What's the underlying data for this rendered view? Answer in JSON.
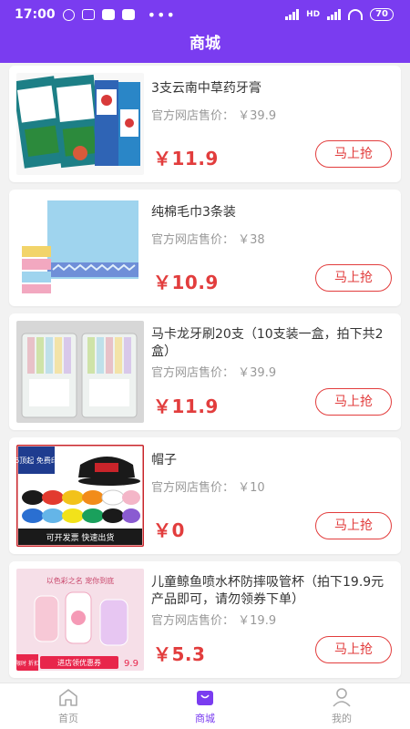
{
  "status_bar": {
    "time": "17:00",
    "more": "•••",
    "network": "HD",
    "battery": "70"
  },
  "header": {
    "title": "商城"
  },
  "products": [
    {
      "name": "3支云南中草药牙膏",
      "ref_label": "官方网店售价：",
      "ref_price": "￥39.9",
      "price": "￥11.9",
      "buy_label": "马上抢",
      "image_icon": "toothpaste-image"
    },
    {
      "name": "纯棉毛巾3条装",
      "ref_label": "官方网店售价：",
      "ref_price": "￥38",
      "price": "￥10.9",
      "buy_label": "马上抢",
      "image_icon": "towel-image"
    },
    {
      "name": "马卡龙牙刷20支（10支装一盒，拍下共2盒）",
      "ref_label": "官方网店售价：",
      "ref_price": "￥39.9",
      "price": "￥11.9",
      "buy_label": "马上抢",
      "image_icon": "toothbrush-image"
    },
    {
      "name": "帽子",
      "ref_label": "官方网店售价：",
      "ref_price": "￥10",
      "price": "￥0",
      "buy_label": "马上抢",
      "image_icon": "cap-image",
      "image_text": {
        "badge": "5顶起 免费印",
        "footer": "可开发票  快速出货"
      }
    },
    {
      "name": "儿童鲸鱼喷水杯防摔吸管杯（拍下19.9元产品即可，请勿领券下单）",
      "ref_label": "官方网店售价：",
      "ref_price": "￥19.9",
      "price": "￥5.3",
      "buy_label": "马上抢",
      "image_icon": "cup-image",
      "image_text": {
        "headline": "以色彩之名 宠你到底",
        "promo_tag": "限时 折扣",
        "coupon": "进店领优惠券",
        "badge_price": "9.9"
      }
    }
  ],
  "tabbar": {
    "items": [
      {
        "label": "首页",
        "icon": "home-icon"
      },
      {
        "label": "商城",
        "icon": "bag-icon"
      },
      {
        "label": "我的",
        "icon": "user-icon"
      }
    ],
    "active": 1
  },
  "colors": {
    "brand": "#7a3cf0",
    "price": "#e23d3d"
  }
}
